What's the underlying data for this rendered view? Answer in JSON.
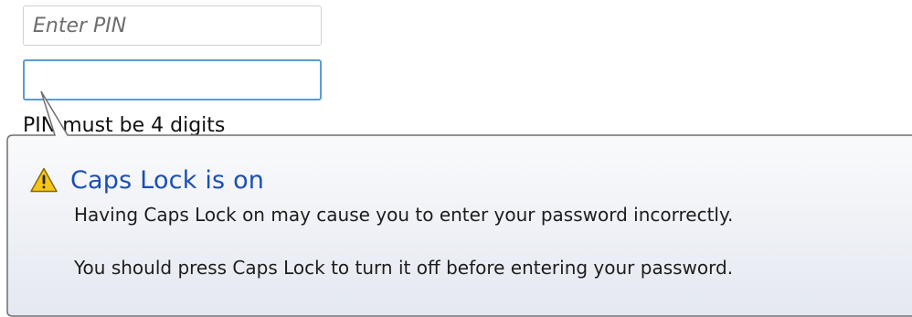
{
  "form": {
    "pin_placeholder": "Enter PIN",
    "pin_value": "",
    "confirm_value": "",
    "helper_text": "PIN must be 4 digits"
  },
  "tooltip": {
    "icon": "warning-icon",
    "title": "Caps Lock is on",
    "line1": "Having Caps Lock on may cause you to enter your password incorrectly.",
    "line2": "You should press Caps Lock to turn it off before entering your password."
  },
  "colors": {
    "title": "#1a4fb5",
    "focus_border": "#5b9bd5",
    "balloon_top": "#ffffff",
    "balloon_bottom": "#e4e8f0",
    "balloon_border": "#6f6f6f",
    "warning_fill": "#f5c518"
  }
}
